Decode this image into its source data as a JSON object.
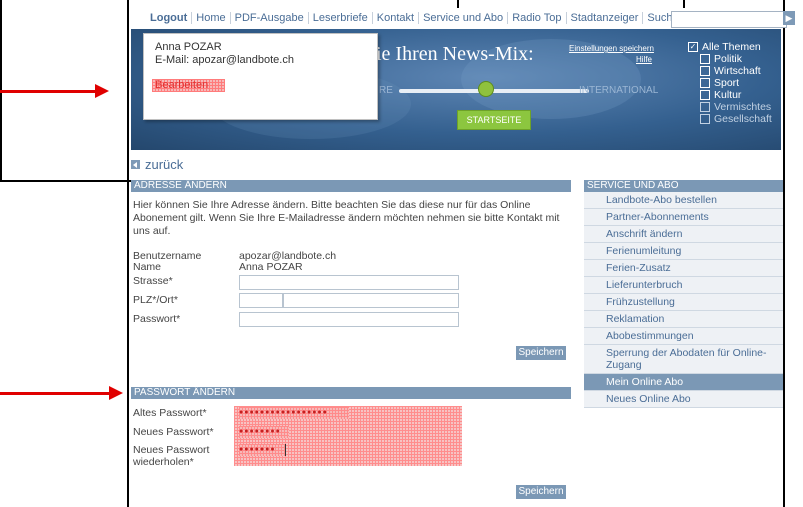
{
  "topnav": {
    "items": [
      "Logout",
      "Home",
      "PDF-Ausgabe",
      "Leserbriefe",
      "Kontakt",
      "Service und Abo",
      "Radio Top",
      "Stadtanzeiger",
      "Suche:"
    ],
    "search_value": ""
  },
  "banner": {
    "title": "ie Ihren News-Mix:",
    "link_settings": "Einstellungen speichern",
    "link_help": "Hilfe",
    "label_left": "RE",
    "label_right": "INTERNATIONAL",
    "start_button": "STARTSEITE",
    "slider_value": 0.45,
    "themes": [
      {
        "label": "Alle Themen",
        "checked": true
      },
      {
        "label": "Politik",
        "checked": false
      },
      {
        "label": "Wirtschaft",
        "checked": false
      },
      {
        "label": "Sport",
        "checked": false
      },
      {
        "label": "Kultur",
        "checked": false
      },
      {
        "label": "Vermischtes",
        "checked": false
      },
      {
        "label": "Gesellschaft",
        "checked": false
      }
    ]
  },
  "popup": {
    "name": "Anna POZAR",
    "email": "E-Mail: apozar@landbote.ch",
    "edit_link": "Bearbeiten"
  },
  "back_link": "zurück",
  "address": {
    "header": "ADRESSE ÄNDERN",
    "intro": "Hier können Sie Ihre Adresse ändern. Bitte beachten Sie das diese nur für das Online Abonement gilt. Wenn Sie Ihre E-Mailadresse ändern möchten nehmen sie bitte Kontakt mit uns auf.",
    "username_label": "Benutzername",
    "username_value": "apozar@landbote.ch",
    "name_label": "Name",
    "name_value": "Anna POZAR",
    "street_label": "Strasse*",
    "zip_label": "PLZ*/Ort*",
    "password_label": "Passwort*",
    "save_button": "Speichern"
  },
  "password": {
    "header": "PASSWORT ÄNDERN",
    "old_label": "Altes Passwort*",
    "old_value": "●●●●●●●●●●●●●●●●●",
    "new_label": "Neues Passwort*",
    "new_value": "●●●●●●●●",
    "repeat_label_1": "Neues Passwort",
    "repeat_label_2": "wiederholen*",
    "repeat_value": "●●●●●●●",
    "save_button": "Speichern"
  },
  "sidebar": {
    "header": "SERVICE UND ABO",
    "items": [
      {
        "label": "Landbote-Abo bestellen",
        "active": false
      },
      {
        "label": "Partner-Abonnements",
        "active": false
      },
      {
        "label": "Anschrift ändern",
        "active": false
      },
      {
        "label": "Ferienumleitung",
        "active": false
      },
      {
        "label": "Ferien-Zusatz",
        "active": false
      },
      {
        "label": "Lieferunterbruch",
        "active": false
      },
      {
        "label": "Frühzustellung",
        "active": false
      },
      {
        "label": "Reklamation",
        "active": false
      },
      {
        "label": "Abobestimmungen",
        "active": false
      },
      {
        "label": "Sperrung der Abodaten für Online-Zugang",
        "active": false
      },
      {
        "label": "Mein Online Abo",
        "active": true
      },
      {
        "label": "Neues Online Abo",
        "active": false
      }
    ]
  },
  "colors": {
    "accent": "#7b98b5",
    "link": "#4a6d96",
    "annotation": "#e00000"
  }
}
